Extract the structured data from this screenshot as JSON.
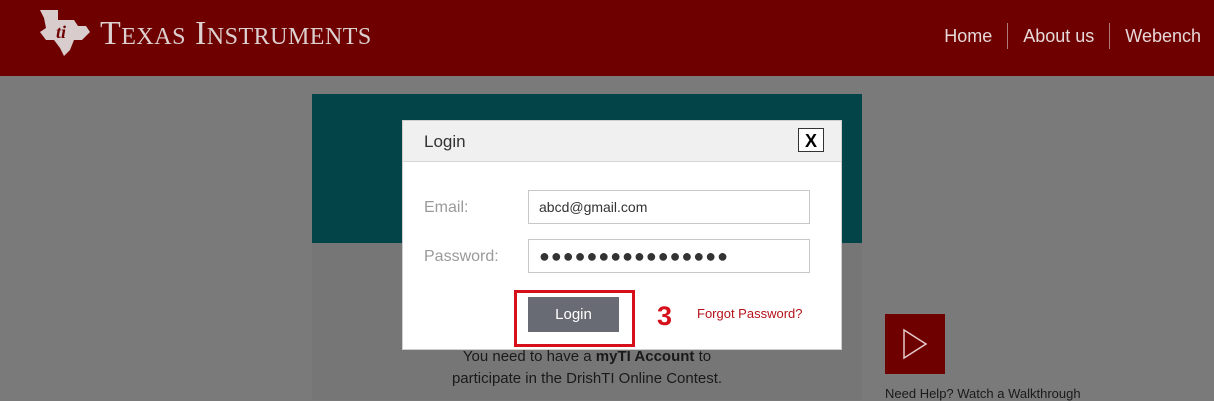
{
  "header": {
    "brand": "Texas Instruments",
    "nav": [
      "Home",
      "About us",
      "Webench"
    ]
  },
  "page": {
    "info_prefix": "You need to have a ",
    "info_bold": "myTI Account",
    "info_suffix": " to",
    "info_line2": "participate in the DrishTI Online Contest.",
    "help_text": "Need Help? Watch a Walkthrough"
  },
  "modal": {
    "title": "Login",
    "close_label": "X",
    "email_label": "Email:",
    "email_value": "abcd@gmail.com",
    "password_label": "Password:",
    "password_value": "●●●●●●●●●●●●●●●●",
    "login_label": "Login",
    "step_number": "3",
    "forgot_label": "Forgot Password?"
  },
  "colors": {
    "header_bg": "#6f0000",
    "banner_bg": "#024448",
    "highlight": "#d6101a",
    "login_button": "#686b73"
  }
}
